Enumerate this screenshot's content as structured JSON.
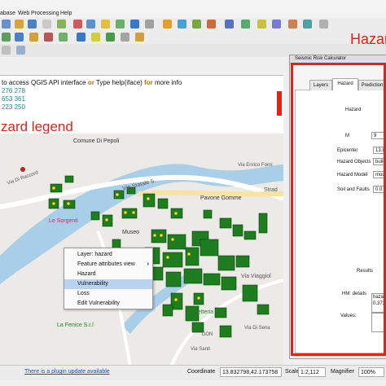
{
  "menubar": {
    "items": [
      "abase",
      "Web",
      "Processing",
      "Help"
    ]
  },
  "console": {
    "line1_prefix": "to access QGIS API interface ",
    "line1_or": "or",
    "line1_mid": " Type help(iface) ",
    "line1_for": "for",
    "line1_suffix": " more info",
    "line2": "276 278",
    "line3": "653 361",
    "line4": "223 250"
  },
  "annotations": {
    "hazard_legend": "zard legend",
    "hazard_top": "Hazar"
  },
  "map": {
    "labels": [
      "Comune Di Pepoli",
      "Via Statale 5",
      "Strad",
      "Pavone Gomme",
      "Le Sorgenti",
      "Museo",
      "Via Viaggiol",
      "La Fenice S.r.l",
      "Caffetteria",
      "Via Santi",
      "Via Di Raccord",
      "Via Enrico Forni",
      "DON",
      "Via Di Sena"
    ]
  },
  "context_menu": {
    "items": [
      "Layer: hazard",
      "Feature attributes view",
      "Hazard",
      "Vulnerability",
      "Loss",
      "Edit Vulnerability"
    ],
    "highlighted": "Vulnerability"
  },
  "dialog": {
    "title": "Seismic Risk Calculator",
    "tabs": [
      "Layers",
      "Hazard",
      "Prediction"
    ],
    "active_tab": "Hazard",
    "section_title": "Hazard",
    "fields": {
      "m_label": "M",
      "m_value": "9",
      "epicenter_label": "Epicenter",
      "epicenter_value": "13.8",
      "hazard_objects_label": "Hazard Objects",
      "hazard_objects_value": "build",
      "hazard_model_label": "Hazard Model",
      "hazard_model_value": "mod",
      "soil_label": "Soil and Faults",
      "soil_value": "0.0",
      "results_label": "Results",
      "hm_details_label": "HM: details",
      "hm_details_value1": "hazar",
      "hm_details_value2": "0.373",
      "values_label": "Values:"
    }
  },
  "status": {
    "plugin_link": "There is a plugin update available",
    "coordinate_label": "Coordinate",
    "coordinate_value": "13.832798,42.173758",
    "scale_label": "Scale",
    "scale_value": "1:2,112",
    "magnifier_label": "Magnifier",
    "magnifier_value": "100%"
  },
  "colors": {
    "accent_red": "#e2231a",
    "building_green": "#1e7d1e",
    "hazard_yellow": "#f5e52a",
    "river_blue": "#a9cfe8",
    "link_blue": "#1a4fd0",
    "console_teal": "#1a8a8a"
  }
}
